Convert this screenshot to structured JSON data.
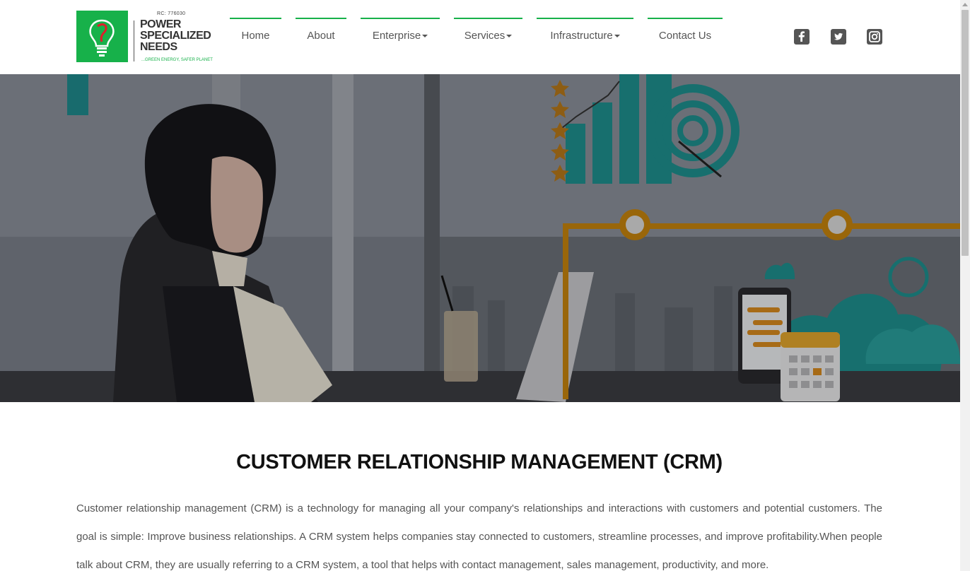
{
  "brand": {
    "rc_number": "RC: 776030",
    "name_line1": "POWER",
    "name_line2": "SPECIALIZED",
    "name_line3": "NEEDS",
    "tagline": "...GREEN ENERGY, SAFER PLANET"
  },
  "nav": {
    "items": [
      {
        "label": "Home",
        "dropdown": false
      },
      {
        "label": "About",
        "dropdown": false
      },
      {
        "label": "Enterprise",
        "dropdown": true
      },
      {
        "label": "Services",
        "dropdown": true
      },
      {
        "label": "Infrastructure",
        "dropdown": true
      },
      {
        "label": "Contact Us",
        "dropdown": false
      }
    ],
    "accent_color": "#17b14a"
  },
  "social": {
    "icons": [
      "facebook-icon",
      "twitter-icon",
      "instagram-icon"
    ]
  },
  "content": {
    "title": "CUSTOMER RELATIONSHIP MANAGEMENT (CRM)",
    "body": "Customer relationship management (CRM) is a technology for managing all your company's relationships and interactions with customers and potential customers. The goal is simple: Improve business relationships. A CRM system helps companies stay connected to customers, streamline processes, and improve profitability.When people talk about CRM, they are usually referring to a CRM system, a tool that helps with contact management, sales management, productivity, and more."
  }
}
